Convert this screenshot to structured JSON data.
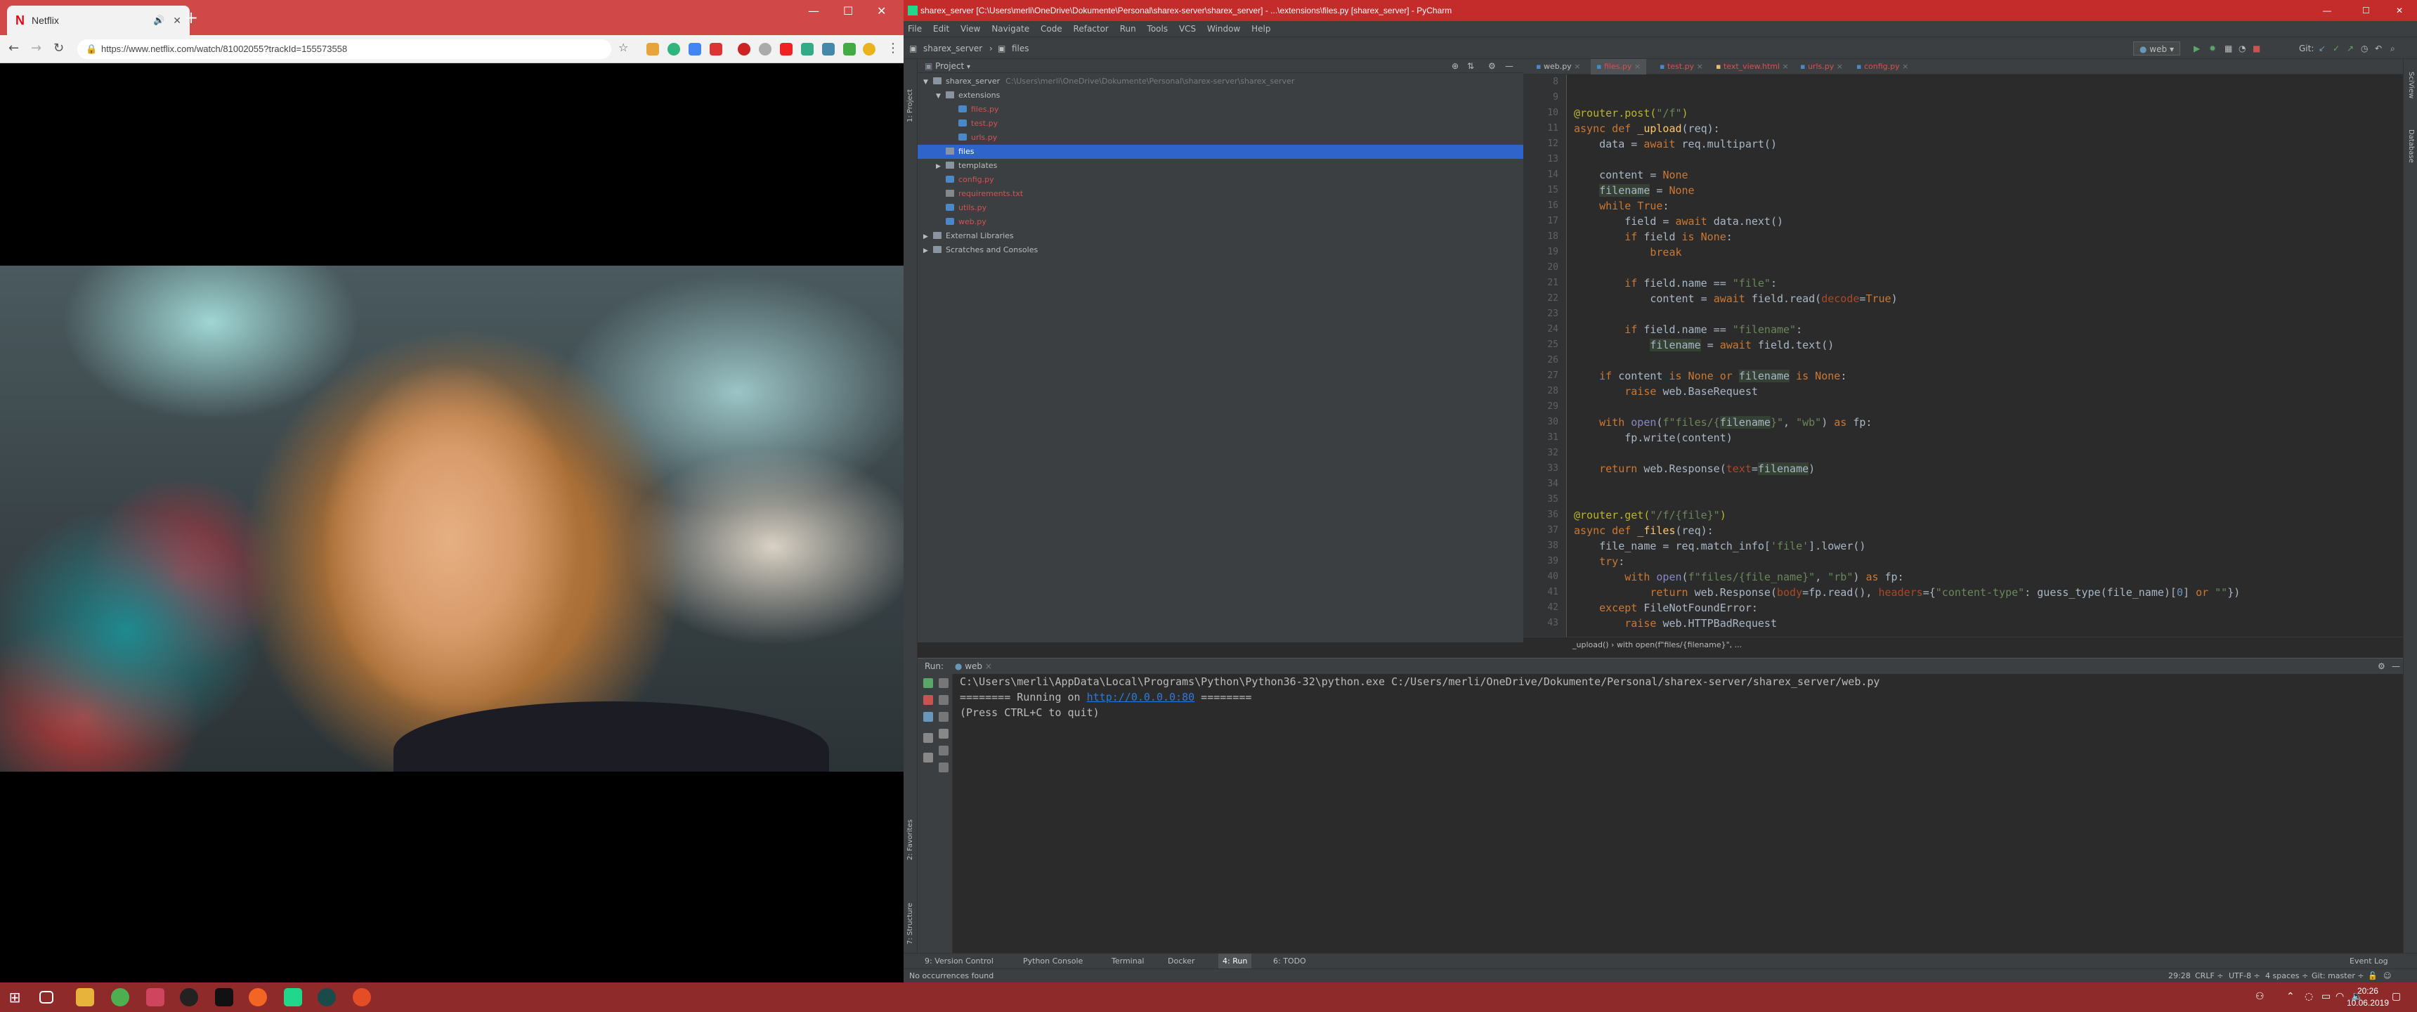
{
  "browser": {
    "tab_title": "Netflix",
    "tab_close": "✕",
    "new_tab": "+",
    "url": "https://www.netflix.com/watch/81002055?trackId=155573558",
    "win_controls": [
      "—",
      "☐",
      "✕"
    ]
  },
  "ide": {
    "title": "sharex_server [C:\\Users\\merli\\OneDrive\\Dokumente\\Personal\\sharex-server\\sharex_server] - ...\\extensions\\files.py [sharex_server] - PyCharm",
    "menu": [
      "File",
      "Edit",
      "View",
      "Navigate",
      "Code",
      "Refactor",
      "Run",
      "Tools",
      "VCS",
      "Window",
      "Help"
    ],
    "nav_breadcrumb": [
      "sharex_server",
      "files"
    ],
    "run_config": "web",
    "git_label": "Git:",
    "win_controls": [
      "—",
      "☐",
      "✕"
    ],
    "project_header": "Project",
    "tree": [
      {
        "label": "sharex_server",
        "extra": "C:\\Users\\merli\\OneDrive\\Dokumente\\Personal\\sharex-server\\sharex_server",
        "indent": 0,
        "type": "folder",
        "arrow": "▼"
      },
      {
        "label": "extensions",
        "indent": 1,
        "type": "folder",
        "arrow": "▼"
      },
      {
        "label": "files.py",
        "indent": 2,
        "type": "py",
        "color": "red"
      },
      {
        "label": "test.py",
        "indent": 2,
        "type": "py",
        "color": "red"
      },
      {
        "label": "urls.py",
        "indent": 2,
        "type": "py",
        "color": "red"
      },
      {
        "label": "files",
        "indent": 1,
        "type": "folder",
        "selected": true
      },
      {
        "label": "templates",
        "indent": 1,
        "type": "folder",
        "arrow": "▶"
      },
      {
        "label": "config.py",
        "indent": 1,
        "type": "py",
        "color": "red"
      },
      {
        "label": "requirements.txt",
        "indent": 1,
        "type": "txt",
        "color": "red"
      },
      {
        "label": "utils.py",
        "indent": 1,
        "type": "py",
        "color": "red"
      },
      {
        "label": "web.py",
        "indent": 1,
        "type": "py",
        "color": "red"
      },
      {
        "label": "External Libraries",
        "indent": 0,
        "type": "folder",
        "arrow": "▶"
      },
      {
        "label": "Scratches and Consoles",
        "indent": 0,
        "type": "folder",
        "arrow": "▶"
      }
    ],
    "editor_tabs": [
      "web.py",
      "files.py",
      "test.py",
      "text_view.html",
      "urls.py",
      "config.py"
    ],
    "active_tab": 1,
    "line_numbers": [
      "8",
      "9",
      "10",
      "11",
      "12",
      "13",
      "14",
      "15",
      "16",
      "17",
      "18",
      "19",
      "20",
      "21",
      "22",
      "23",
      "24",
      "25",
      "26",
      "27",
      "28",
      "29",
      "30",
      "31",
      "32",
      "33",
      "34",
      "35",
      "36",
      "37",
      "38",
      "39",
      "40",
      "41",
      "42",
      "43"
    ],
    "code_breadcrumb": "_upload()   ›   with open(f\"files/{filename}\", ...",
    "left_strip_labels": [
      "1: Project",
      "2: Favorites",
      "7: Structure"
    ],
    "right_strip_labels": [
      "SciView",
      "Database"
    ],
    "run_tab": "Run:",
    "run_config_tab": "web",
    "console_lines": [
      "C:\\Users\\merli\\AppData\\Local\\Programs\\Python\\Python36-32\\python.exe C:/Users/merli/OneDrive/Dokumente/Personal/sharex-server/sharex_server/web.py",
      "======== Running on ",
      "http://0.0.0.0:80",
      " ========",
      "(Press CTRL+C to quit)"
    ],
    "tool_windows": [
      "9: Version Control",
      "Python Console",
      "Terminal",
      "Docker",
      "4: Run",
      "6: TODO"
    ],
    "event_log": "Event Log",
    "status_left": "No occurrences found",
    "status_right": [
      "29:28",
      "CRLF ÷",
      "UTF-8 ÷",
      "4 spaces ÷",
      "Git: master ÷"
    ]
  },
  "taskbar": {
    "time": "20:26",
    "date": "10.06.2019"
  }
}
